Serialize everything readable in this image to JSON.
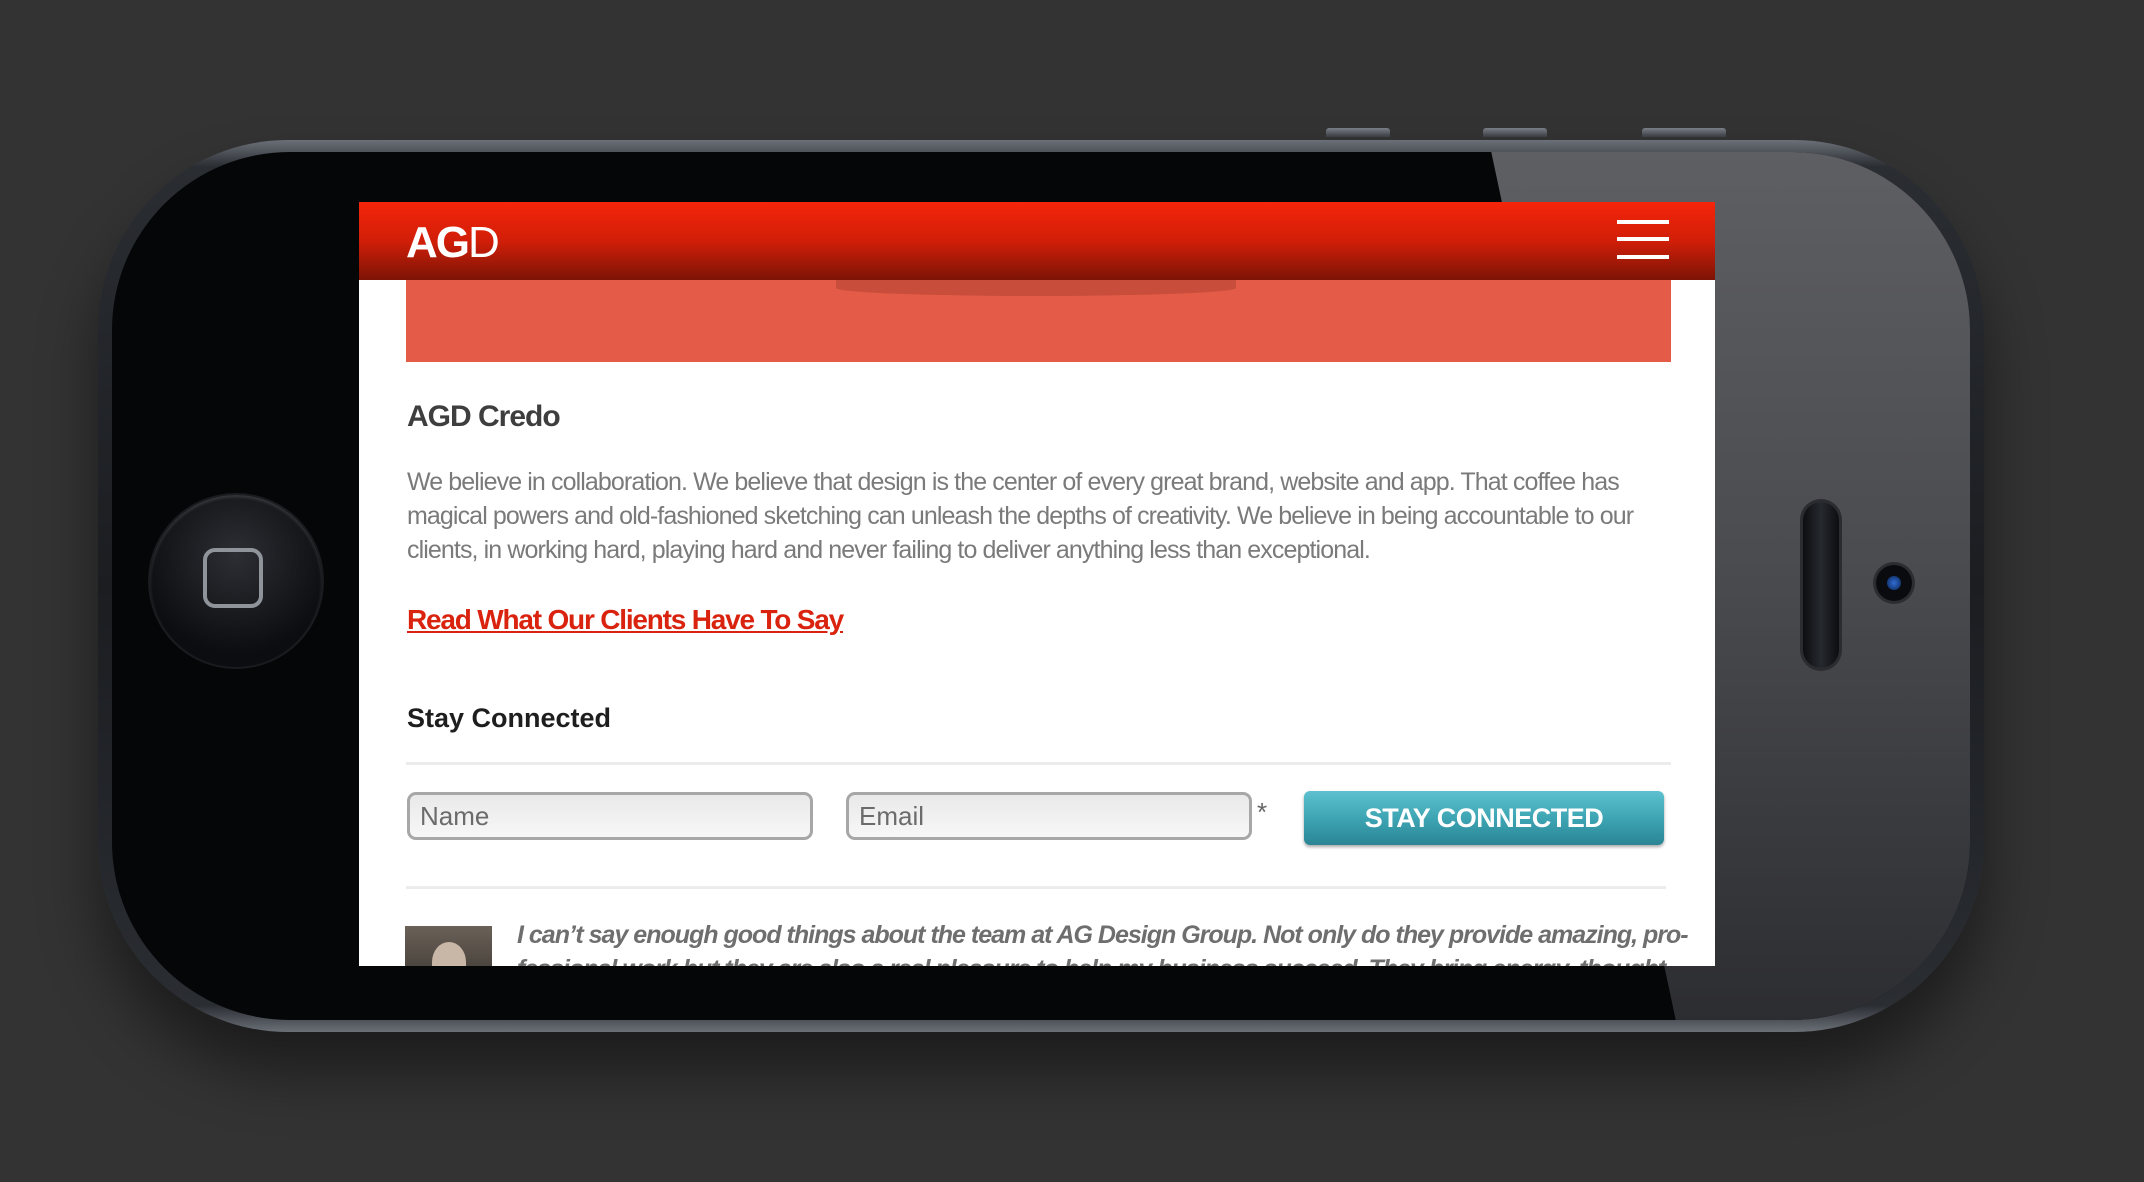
{
  "header": {
    "logo_bold": "AG",
    "logo_thin": "D"
  },
  "credo": {
    "title": "AGD Credo",
    "text": "We believe in collaboration. We believe that design is the center of every great brand, website and app. That coffee has magical powers and old-fashioned sketching can unleash the depths of creativity. We believe in being accountable to our clients, in working hard, playing hard and never failing to deliver anything less than exceptional."
  },
  "clients_link": "Read What Our Clients Have To Say",
  "newsletter": {
    "title": "Stay Connected",
    "name_placeholder": "Name",
    "email_placeholder": "Email",
    "required_mark": "*",
    "button_label": "STAY CONNECTED"
  },
  "testimonial": {
    "text": "I can’t say enough good things about the team at AG Design Group. Not only do they provide amazing, pro-fessional work but they are also a real pleasure to help my business succeed. They bring energy, thought and creativity"
  },
  "colors": {
    "brand_red": "#d9230e",
    "button_teal": "#3ea5b4"
  }
}
